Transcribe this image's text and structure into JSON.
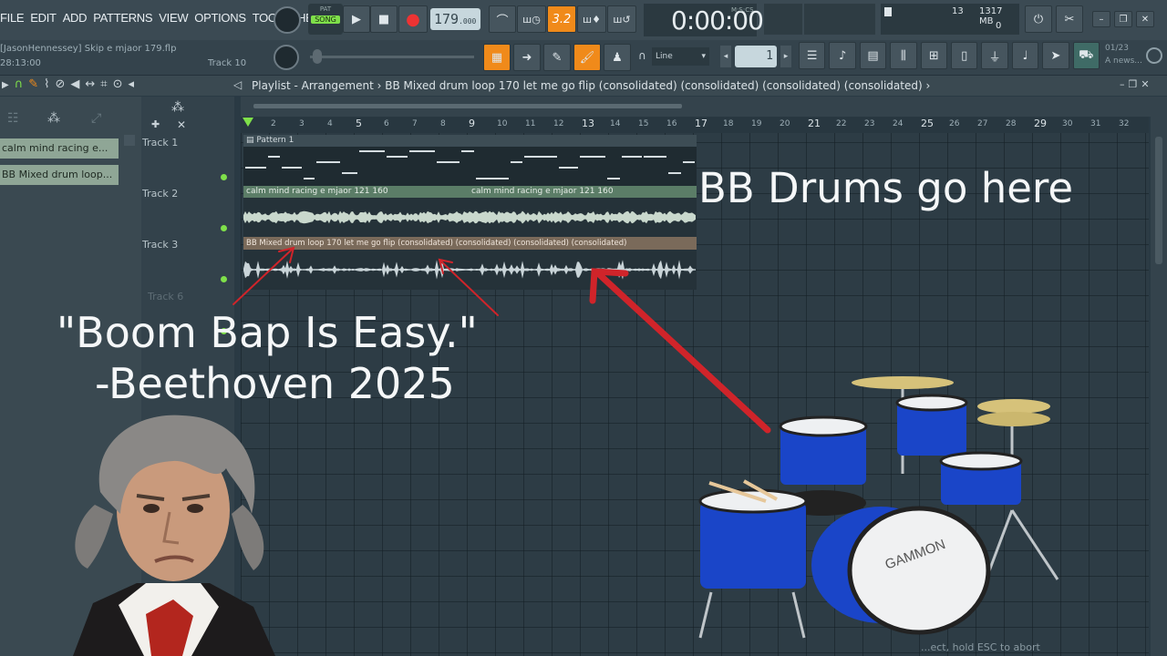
{
  "menu": [
    "FILE",
    "EDIT",
    "ADD",
    "PATTERNS",
    "VIEW",
    "OPTIONS",
    "TOOLS",
    "HELP"
  ],
  "transport": {
    "mode_top": "PAT",
    "mode_bottom": "SONG",
    "tempo": "179",
    "tempo_decimal": ".000",
    "time": "0:00:00",
    "time_unit": "M:S:CS",
    "pattern_num": "3.2",
    "cpu_label": "13",
    "ram_label": "1317 MB",
    "poly": "0"
  },
  "hint": {
    "title": "[JasonHennessey] Skip e mjaor 179.flp",
    "time": "28:13:00",
    "track": "Track 10"
  },
  "snap": {
    "value": "Line"
  },
  "step": {
    "value": "1"
  },
  "news": {
    "date": "01/23",
    "text": "A news..."
  },
  "playlist": {
    "path": "Playlist - Arrangement › BB Mixed drum loop 170 let me go flip (consolidated) (consolidated) (consolidated) (consolidated) ›"
  },
  "picker": [
    "calm mind racing e...",
    "BB Mixed drum loop..."
  ],
  "tracks": [
    "Track 1",
    "Track 2",
    "Track 3",
    "Track 6"
  ],
  "clips": {
    "pattern": "Pattern 1",
    "audio1a": "calm mind racing e mjaor 121 160",
    "audio1b": "calm mind racing e mjaor 121 160",
    "drums": "BB Mixed drum loop 170 let me go flip (consolidated) (consolidated) (consolidated) (consolidated)"
  },
  "ruler": [
    "2",
    "3",
    "4",
    "5",
    "6",
    "7",
    "8",
    "9",
    "10",
    "11",
    "12",
    "13",
    "14",
    "15",
    "16",
    "17",
    "18",
    "19",
    "20",
    "21",
    "22",
    "23",
    "24",
    "25",
    "26",
    "27",
    "28",
    "29",
    "30",
    "31",
    "32"
  ],
  "overlay": {
    "drums_note": "BB Drums go here",
    "quote": "\"Boom Bap Is Easy.\"",
    "attribution": "-Beethoven 2025",
    "drum_brand": "GAMMON",
    "esc_hint": "...ect, hold ESC to abort"
  },
  "colors": {
    "accent_orange": "#f08a1a",
    "arrow_red": "#d0242a",
    "drum_blue": "#1a45c8"
  }
}
